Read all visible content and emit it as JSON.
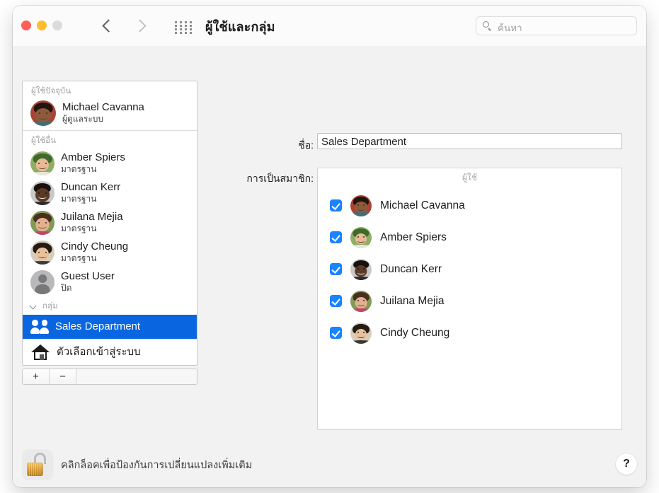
{
  "window": {
    "title": "ผู้ใช้และกลุ่ม",
    "traffic_lights": [
      "close",
      "minimize",
      "zoom"
    ],
    "nav": {
      "back": "‹",
      "forward": "›",
      "grid": "show-all"
    }
  },
  "search": {
    "placeholder": "ค้นหา",
    "value": "",
    "icon": "search-icon"
  },
  "sidebar": {
    "sections": [
      {
        "header": "ผู้ใช้ปัจจุบัน",
        "items": [
          {
            "name": "Michael Cavanna",
            "role": "ผู้ดูแลระบบ",
            "avatar": "michael"
          }
        ]
      },
      {
        "header": "ผู้ใช้อื่น",
        "items": [
          {
            "name": "Amber Spiers",
            "role": "มาตรฐาน",
            "avatar": "amber"
          },
          {
            "name": "Duncan Kerr",
            "role": "มาตรฐาน",
            "avatar": "duncan"
          },
          {
            "name": "Juilana Mejia",
            "role": "มาตรฐาน",
            "avatar": "juilana"
          },
          {
            "name": "Cindy Cheung",
            "role": "มาตรฐาน",
            "avatar": "cindy"
          },
          {
            "name": "Guest User",
            "role": "ปิด",
            "avatar": "guest"
          }
        ]
      },
      {
        "header": "กลุ่ม",
        "items": [
          {
            "name": "Sales Department",
            "role": "",
            "avatar": "group",
            "selected": true
          }
        ]
      }
    ],
    "login_options": "ตัวเลือกเข้าสู่ระบบ",
    "add_button": "+",
    "remove_button": "−"
  },
  "pane": {
    "name_label": "ชื่อ:",
    "name_value": "Sales Department",
    "membership_label": "การเป็นสมาชิก:",
    "members_column_header": "ผู้ใช้",
    "members": [
      {
        "name": "Michael Cavanna",
        "checked": true,
        "avatar": "michael"
      },
      {
        "name": "Amber Spiers",
        "checked": true,
        "avatar": "amber"
      },
      {
        "name": "Duncan Kerr",
        "checked": true,
        "avatar": "duncan"
      },
      {
        "name": "Juilana Mejia",
        "checked": true,
        "avatar": "juilana"
      },
      {
        "name": "Cindy Cheung",
        "checked": true,
        "avatar": "cindy"
      }
    ]
  },
  "footer": {
    "lock_text": "คลิกล็อคเพื่อป้องกันการเปลี่ยนแปลงเพิ่มเติม",
    "lock_state": "unlocked",
    "help_label": "?"
  },
  "colors": {
    "selection_blue": "#0a66e0",
    "checkbox_blue": "#1a84ff",
    "window_bg": "#f2f2f2",
    "titlebar_bg": "#fbfbfb"
  }
}
